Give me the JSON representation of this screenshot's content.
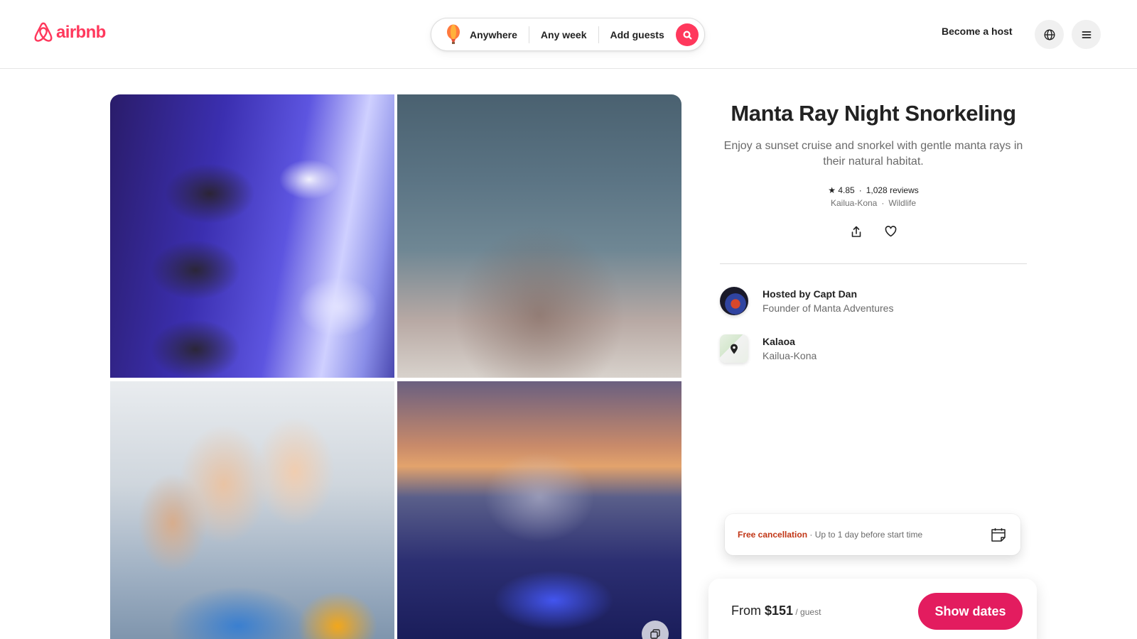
{
  "header": {
    "logo_text": "airbnb",
    "search": {
      "location": "Anywhere",
      "dates": "Any week",
      "guests": "Add guests"
    },
    "become_host": "Become a host"
  },
  "listing": {
    "title": "Manta Ray Night Snorkeling",
    "description": "Enjoy a sunset cruise and snorkel with gentle manta rays in their natural habitat.",
    "rating": "4.85",
    "reviews": "1,028 reviews",
    "location": "Kailua-Kona",
    "category": "Wildlife"
  },
  "host": {
    "title": "Hosted by Capt Dan",
    "subtitle": "Founder of Manta Adventures"
  },
  "place": {
    "title": "Kalaoa",
    "subtitle": "Kailua-Kona"
  },
  "cancellation": {
    "label": "Free cancellation",
    "detail": " · Up to 1 day before start time"
  },
  "booking": {
    "from": "From ",
    "price": "$151",
    "unit": " / guest",
    "button": "Show dates"
  },
  "colors": {
    "brand": "#ff385c",
    "cta": "#e31c5f",
    "cancellation": "#c13515"
  },
  "icons": [
    "airbnb-logo-icon",
    "balloon-icon",
    "search-icon",
    "globe-icon",
    "menu-icon",
    "share-icon",
    "heart-icon",
    "map-pin-icon",
    "calendar-icon",
    "gallery-icon"
  ]
}
